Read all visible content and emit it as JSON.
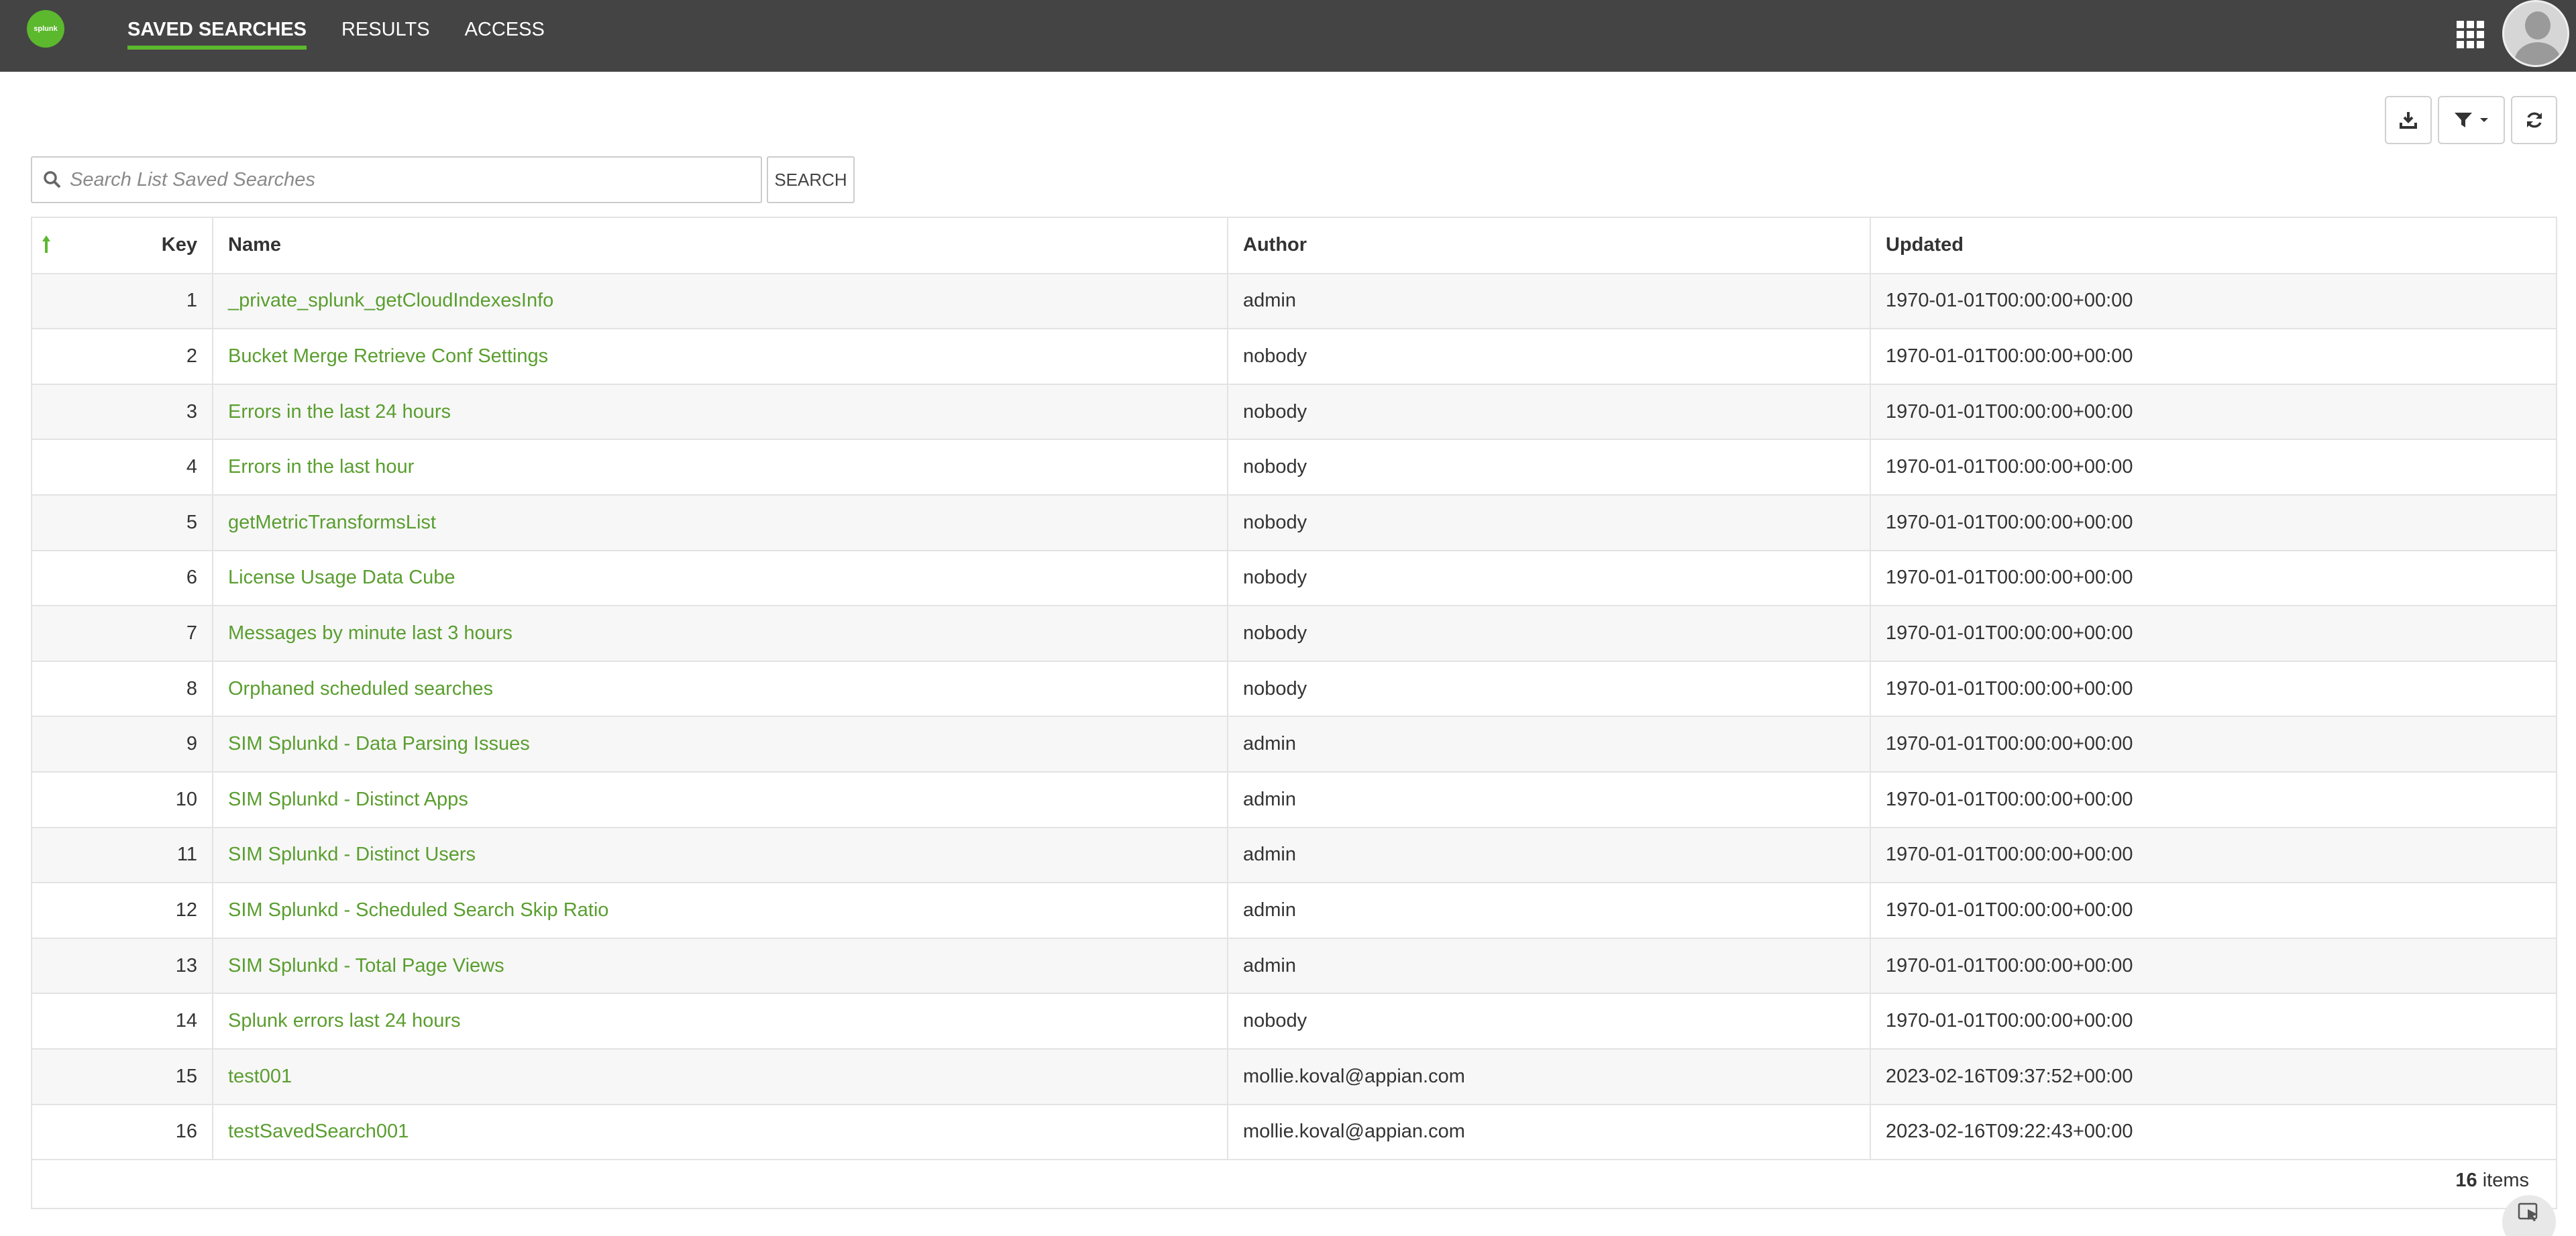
{
  "brand": {
    "logo_text": "splunk"
  },
  "nav": {
    "tabs": [
      {
        "label": "SAVED SEARCHES",
        "active": true
      },
      {
        "label": "RESULTS",
        "active": false
      },
      {
        "label": "ACCESS",
        "active": false
      }
    ]
  },
  "header": {
    "apps_icon": "apps-grid-icon",
    "avatar_icon": "user-avatar"
  },
  "toolbar": {
    "icons": [
      "download-icon",
      "filter-icon",
      "refresh-icon"
    ]
  },
  "search": {
    "placeholder": "Search List Saved Searches",
    "value": "",
    "button_label": "SEARCH"
  },
  "table": {
    "sort": {
      "column": "Key",
      "direction": "ascending"
    },
    "columns": [
      "Key",
      "Name",
      "Author",
      "Updated"
    ],
    "rows": [
      {
        "key": "1",
        "name": "_private_splunk_getCloudIndexesInfo",
        "author": "admin",
        "updated": "1970-01-01T00:00:00+00:00"
      },
      {
        "key": "2",
        "name": "Bucket Merge Retrieve Conf Settings",
        "author": "nobody",
        "updated": "1970-01-01T00:00:00+00:00"
      },
      {
        "key": "3",
        "name": "Errors in the last 24 hours",
        "author": "nobody",
        "updated": "1970-01-01T00:00:00+00:00"
      },
      {
        "key": "4",
        "name": "Errors in the last hour",
        "author": "nobody",
        "updated": "1970-01-01T00:00:00+00:00"
      },
      {
        "key": "5",
        "name": "getMetricTransformsList",
        "author": "nobody",
        "updated": "1970-01-01T00:00:00+00:00"
      },
      {
        "key": "6",
        "name": "License Usage Data Cube",
        "author": "nobody",
        "updated": "1970-01-01T00:00:00+00:00"
      },
      {
        "key": "7",
        "name": "Messages by minute last 3 hours",
        "author": "nobody",
        "updated": "1970-01-01T00:00:00+00:00"
      },
      {
        "key": "8",
        "name": "Orphaned scheduled searches",
        "author": "nobody",
        "updated": "1970-01-01T00:00:00+00:00"
      },
      {
        "key": "9",
        "name": "SIM Splunkd - Data Parsing Issues",
        "author": "admin",
        "updated": "1970-01-01T00:00:00+00:00"
      },
      {
        "key": "10",
        "name": "SIM Splunkd - Distinct Apps",
        "author": "admin",
        "updated": "1970-01-01T00:00:00+00:00"
      },
      {
        "key": "11",
        "name": "SIM Splunkd - Distinct Users",
        "author": "admin",
        "updated": "1970-01-01T00:00:00+00:00"
      },
      {
        "key": "12",
        "name": "SIM Splunkd - Scheduled Search Skip Ratio",
        "author": "admin",
        "updated": "1970-01-01T00:00:00+00:00"
      },
      {
        "key": "13",
        "name": "SIM Splunkd - Total Page Views",
        "author": "admin",
        "updated": "1970-01-01T00:00:00+00:00"
      },
      {
        "key": "14",
        "name": "Splunk errors last 24 hours",
        "author": "nobody",
        "updated": "1970-01-01T00:00:00+00:00"
      },
      {
        "key": "15",
        "name": "test001",
        "author": "mollie.koval@appian.com",
        "updated": "2023-02-16T09:37:52+00:00"
      },
      {
        "key": "16",
        "name": "testSavedSearch001",
        "author": "mollie.koval@appian.com",
        "updated": "2023-02-16T09:22:43+00:00"
      }
    ],
    "footer": {
      "count": "16",
      "count_label": "items"
    }
  },
  "colors": {
    "topbar": "#444444",
    "accent": "#5cb82d",
    "link": "#5a9e2f"
  }
}
